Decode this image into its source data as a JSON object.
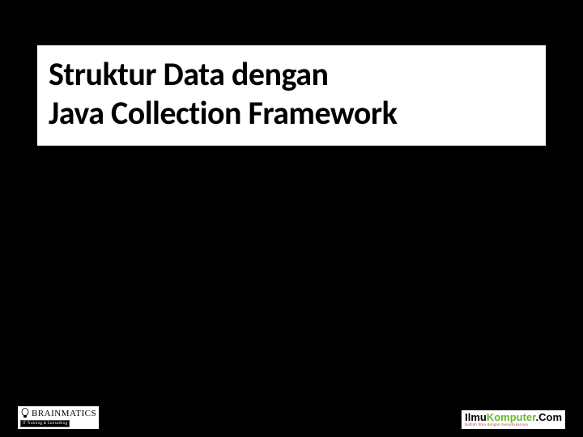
{
  "title": {
    "line1": "Struktur Data dengan",
    "line2": "Java Collection Framework"
  },
  "footer": {
    "left_logo": {
      "name": "BRAINMATICS",
      "subtitle": "IT Training & Consulting"
    },
    "right_logo": {
      "part1": "Ilmu",
      "part2": "Komputer",
      "part3": ".Com",
      "tagline": "Ikatlah Ilmu dengan menuliskannya"
    }
  }
}
